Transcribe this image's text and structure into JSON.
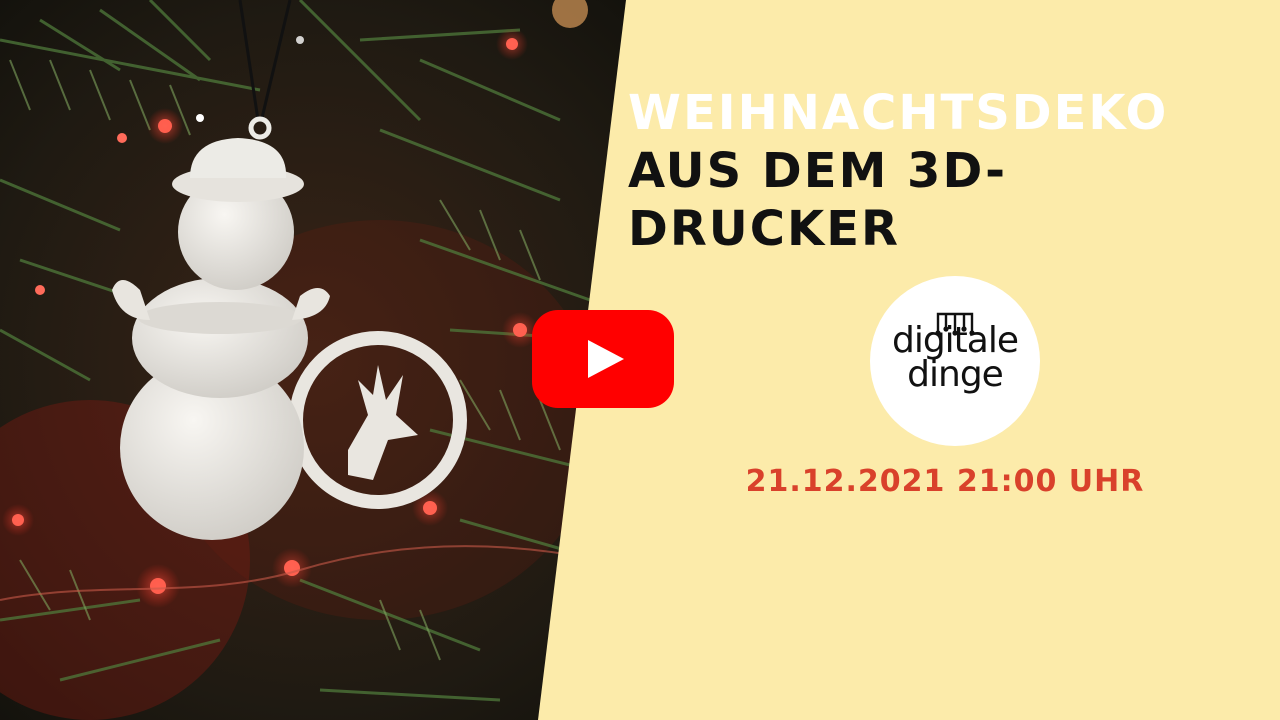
{
  "title": {
    "line1": "WEIHNACHTSDEKO",
    "line2": "AUS DEM 3D-DRUCKER"
  },
  "logo": {
    "word1": "digitale",
    "word2": "dinge"
  },
  "date_time": "21.12.2021 21:00 UHR",
  "play_button": {
    "icon": "youtube-play-icon",
    "color": "#FF0000"
  },
  "colors": {
    "panel": "#FCEBAA",
    "title_accent": "#FFFFFF",
    "title_main": "#111111",
    "date": "#D9412B"
  }
}
